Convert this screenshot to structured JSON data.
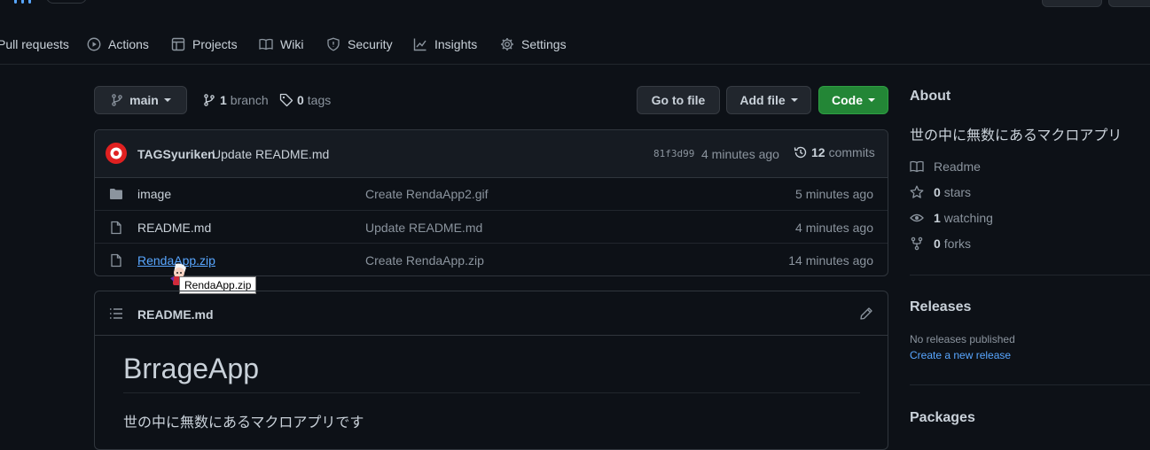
{
  "nav": {
    "items": [
      {
        "label": "Pull requests",
        "icon": "pull-request-icon"
      },
      {
        "label": "Actions",
        "icon": "play-icon"
      },
      {
        "label": "Projects",
        "icon": "table-icon"
      },
      {
        "label": "Wiki",
        "icon": "book-icon"
      },
      {
        "label": "Security",
        "icon": "shield-icon"
      },
      {
        "label": "Insights",
        "icon": "graph-icon"
      },
      {
        "label": "Settings",
        "icon": "gear-icon"
      }
    ]
  },
  "branch": {
    "current": "main",
    "branch_count": "1",
    "branch_word": "branch",
    "tag_count": "0",
    "tag_word": "tags"
  },
  "actions": {
    "go_to_file": "Go to file",
    "add_file": "Add file",
    "code": "Code"
  },
  "commit": {
    "author": "TAGSyuriken",
    "message": "Update README.md",
    "sha": "81f3d99",
    "age": "4 minutes ago",
    "count": "12",
    "count_word": "commits"
  },
  "files": [
    {
      "name": "image",
      "type": "folder",
      "message": "Create RendaApp2.gif",
      "age": "5 minutes ago"
    },
    {
      "name": "README.md",
      "type": "file",
      "message": "Update README.md",
      "age": "4 minutes ago"
    },
    {
      "name": "RendaApp.zip",
      "type": "file",
      "message": "Create RendaApp.zip",
      "age": "14 minutes ago"
    }
  ],
  "tooltip": "RendaApp.zip",
  "readme": {
    "filename": "README.md",
    "heading": "BrrageApp",
    "body": "世の中に無数にあるマクロアプリです"
  },
  "about": {
    "title": "About",
    "description": "世の中に無数にあるマクロアプリ",
    "readme_label": "Readme",
    "stars_count": "0",
    "stars_word": "stars",
    "watching_count": "1",
    "watching_word": "watching",
    "forks_count": "0",
    "forks_word": "forks"
  },
  "releases": {
    "title": "Releases",
    "none_text": "No releases published",
    "create_link": "Create a new release"
  },
  "packages": {
    "title": "Packages"
  },
  "colors": {
    "background": "#0d1117",
    "border": "#30363d",
    "accent_link": "#58a6ff",
    "code_button": "#238636"
  }
}
